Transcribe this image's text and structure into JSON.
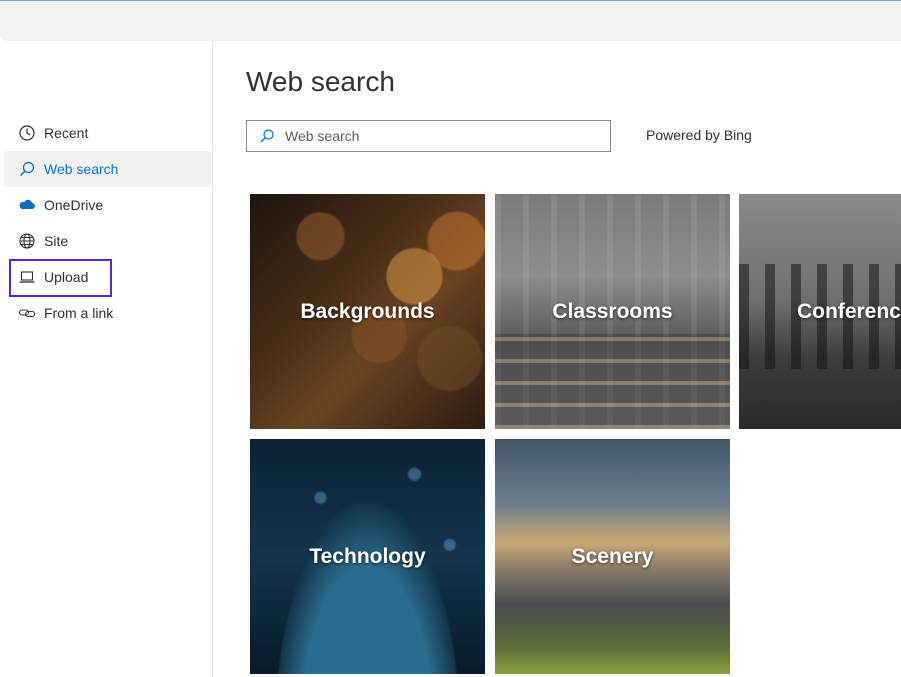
{
  "page": {
    "title": "Web search"
  },
  "search": {
    "placeholder": "Web search",
    "value": ""
  },
  "powered_by": "Powered by Bing",
  "sidebar": {
    "items": [
      {
        "label": "Recent",
        "icon": "clock-icon",
        "active": false
      },
      {
        "label": "Web search",
        "icon": "search-icon",
        "active": true
      },
      {
        "label": "OneDrive",
        "icon": "cloud-icon",
        "active": false
      },
      {
        "label": "Site",
        "icon": "globe-icon",
        "active": false
      },
      {
        "label": "Upload",
        "icon": "laptop-icon",
        "active": false
      },
      {
        "label": "From a link",
        "icon": "link-icon",
        "active": false
      }
    ]
  },
  "categories": [
    {
      "label": "Backgrounds"
    },
    {
      "label": "Classrooms"
    },
    {
      "label": "Conference"
    },
    {
      "label": "Technology"
    },
    {
      "label": "Scenery"
    }
  ],
  "colors": {
    "accent": "#0078d4",
    "focus_outline": "#5b24d6",
    "active_bg": "#f3f2f1"
  }
}
